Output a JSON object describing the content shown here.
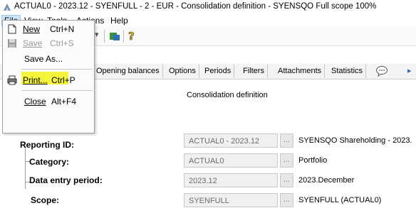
{
  "window": {
    "title": "ACTUAL0 - 2023.12 - SYENFULL - 2 - EUR - Consolidation definition - SYENSQO Full scope 100%"
  },
  "menubar": {
    "items": [
      "File",
      "View",
      "Tools",
      "Actions",
      "Help"
    ]
  },
  "file_menu": {
    "new_label": "New",
    "new_shortcut": "Ctrl+N",
    "save_label": "Save",
    "save_shortcut": "Ctrl+S",
    "save_as_label": "Save As...",
    "print_label": "Print...",
    "print_shortcut": "Ctrl+P",
    "close_label": "Close",
    "close_shortcut": "Alt+F4",
    "highlight_color": "#f5f53c"
  },
  "tabs": [
    "Opening balances",
    "Options",
    "Periods",
    "Filters",
    "Attachments",
    "Statistics"
  ],
  "panel": {
    "heading": "Consolidation definition"
  },
  "form": {
    "reporting_id": {
      "label": "Reporting ID:",
      "value": "ACTUAL0 - 2023.12",
      "description": "SYENSQO Shareholding - 2023."
    },
    "category": {
      "label": "Category:",
      "value": "ACTUAL0",
      "description": "Portfolio"
    },
    "period": {
      "label": "Data entry period:",
      "value": "2023.12",
      "description": "2023.December"
    },
    "scope": {
      "label": "Scope:",
      "value": "SYENFULL",
      "description": "SYENFULL (ACTUAL0)"
    },
    "browse_label": "..."
  }
}
